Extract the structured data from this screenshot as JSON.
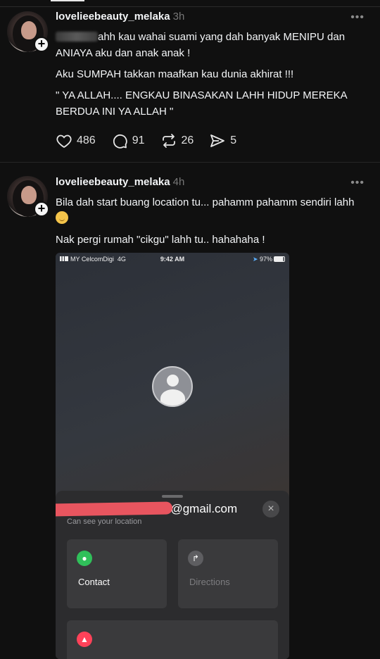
{
  "posts": [
    {
      "username": "lovelieebeauty_melaka",
      "time": "3h",
      "lines": [
        "ahh kau wahai suami yang dah banyak MENIPU dan ANIAYA aku dan anak anak !",
        "Aku SUMPAH takkan maafkan kau dunia akhirat !!!",
        "\" YA ALLAH.... ENGKAU BINASAKAN LAHH HIDUP MEREKA BERDUA INI YA ALLAH \""
      ],
      "likes": "486",
      "comments": "91",
      "reposts": "26",
      "shares": "5"
    },
    {
      "username": "lovelieebeauty_melaka",
      "time": "4h",
      "lines": [
        "Bila dah start buang location tu... pahamm pahamm sendiri lahh",
        "Nak pergi rumah \"cikgu\" lahh tu.. hahahaha !"
      ]
    }
  ],
  "screenshot": {
    "carrier": "MY CelcomDigi",
    "network": "4G",
    "clock": "9:42 AM",
    "battery": "97%",
    "email": "0@gmail.com",
    "subtitle": "Can see your location",
    "close_icon": "×",
    "cards": {
      "contact": "Contact",
      "directions": "Directions"
    }
  },
  "icons": {
    "more": "•••",
    "plus": "+"
  },
  "colors": {
    "background": "#101010",
    "redaction": "#e8555f",
    "contact_green": "#30c05a",
    "alert_red": "#ff4259"
  }
}
